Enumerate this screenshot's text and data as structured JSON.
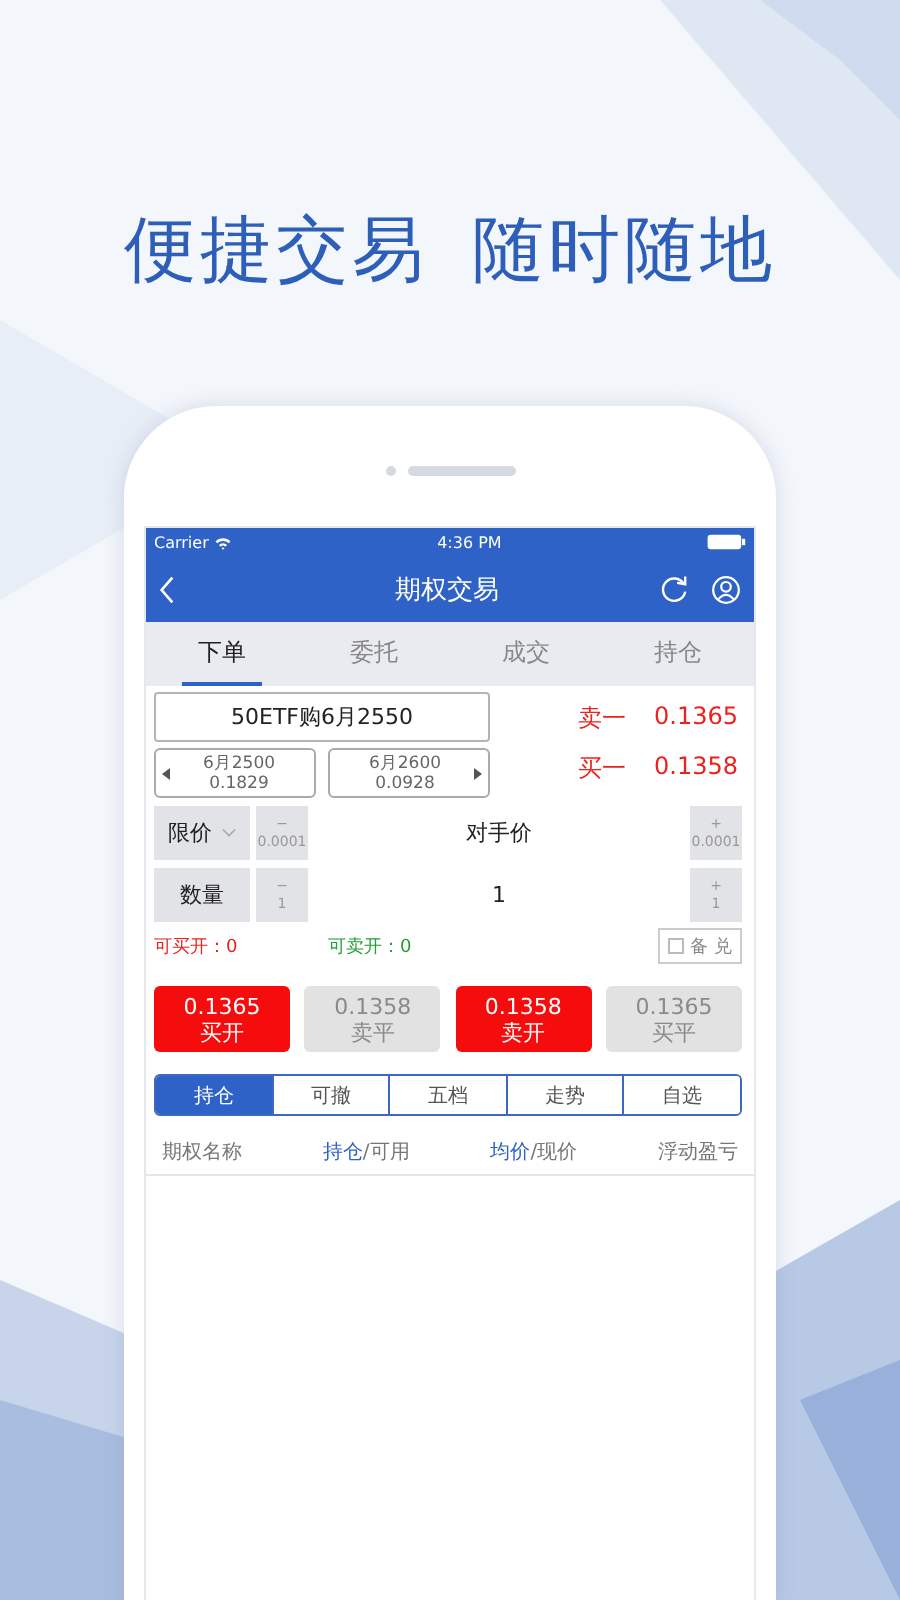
{
  "headline": [
    "便捷交易",
    "随时随地"
  ],
  "status_bar": {
    "carrier": "Carrier",
    "time": "4:36 PM"
  },
  "nav": {
    "title": "期权交易"
  },
  "tabs": [
    {
      "label": "下单",
      "selected": true
    },
    {
      "label": "委托",
      "selected": false
    },
    {
      "label": "成交",
      "selected": false
    },
    {
      "label": "持仓",
      "selected": false
    }
  ],
  "contract": {
    "name": "50ETF购6月2550",
    "prev": {
      "label": "6月2500",
      "price": "0.1829"
    },
    "next": {
      "label": "6月2600",
      "price": "0.0928"
    }
  },
  "quotes": [
    {
      "label": "卖一",
      "price": "0.1365"
    },
    {
      "label": "买一",
      "price": "0.1358"
    }
  ],
  "steppers": [
    {
      "label": "限价",
      "dropdown": true,
      "minus": "−",
      "minus_step": "0.0001",
      "value": "对手价",
      "plus": "+",
      "plus_step": "0.0001"
    },
    {
      "label": "数量",
      "dropdown": false,
      "minus": "−",
      "minus_step": "1",
      "value": "1",
      "plus": "+",
      "plus_step": "1"
    }
  ],
  "available": [
    {
      "text": "可买开：0",
      "color": "#e8231f"
    },
    {
      "text": "可卖开：0",
      "color": "#22a032"
    }
  ],
  "covered": {
    "label": "备 兑",
    "checked": false
  },
  "order_buttons": [
    {
      "price": "0.1365",
      "action": "买开",
      "disabled": false
    },
    {
      "price": "0.1358",
      "action": "卖平",
      "disabled": true
    },
    {
      "price": "0.1358",
      "action": "卖开",
      "disabled": false
    },
    {
      "price": "0.1365",
      "action": "买平",
      "disabled": true
    }
  ],
  "segments": [
    {
      "label": "持仓",
      "selected": true
    },
    {
      "label": "可撤",
      "selected": false
    },
    {
      "label": "五档",
      "selected": false
    },
    {
      "label": "走势",
      "selected": false
    },
    {
      "label": "自选",
      "selected": false
    }
  ],
  "columns": [
    {
      "rest": "期权名称"
    },
    {
      "accent": "持仓",
      "rest": "/可用"
    },
    {
      "accent": "均价",
      "rest": "/现价"
    },
    {
      "rest": "浮动盈亏"
    }
  ]
}
